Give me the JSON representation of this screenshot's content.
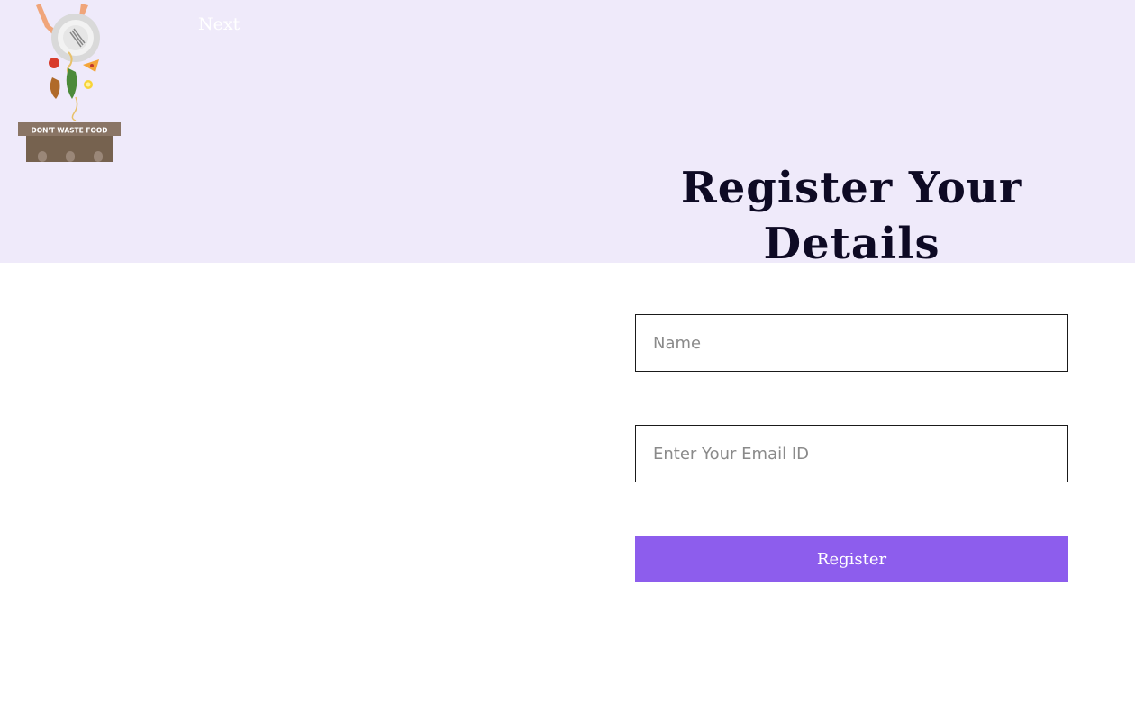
{
  "header": {
    "logo": {
      "alt": "Don't waste food logo",
      "banner_text": "DON'T WASTE FOOD"
    },
    "nav": {
      "next_label": "Next"
    }
  },
  "form": {
    "title": "Register Your Details",
    "name_placeholder": "Name",
    "email_placeholder": "Enter Your Email ID",
    "submit_label": "Register"
  },
  "colors": {
    "band_background": "#efeafa",
    "button_accent": "#8d5ded",
    "title_color": "#0e0a24"
  }
}
